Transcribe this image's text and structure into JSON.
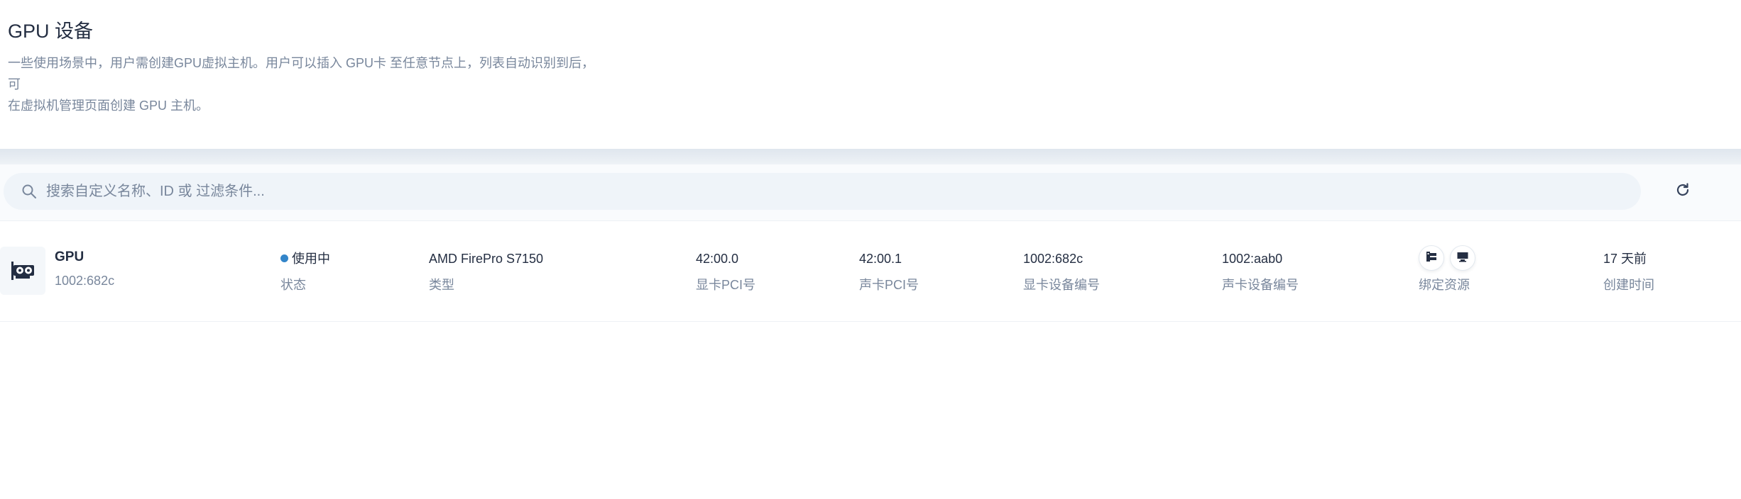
{
  "header": {
    "title": "GPU 设备",
    "description_line1": "一些使用场景中，用户需创建GPU虚拟主机。用户可以插入 GPU卡 至任意节点上，列表自动识别到后，可",
    "description_line2": "在虚拟机管理页面创建 GPU 主机。"
  },
  "toolbar": {
    "search_placeholder": "搜索自定义名称、ID 或 过滤条件...",
    "search_value": "",
    "search_icon": "search-icon",
    "refresh_icon": "refresh-icon"
  },
  "device": {
    "icon": "gpu-card-icon",
    "name": "GPU",
    "id": "1002:682c",
    "status_value": "使用中",
    "status_label": "状态",
    "status_color": "#3385c9",
    "type_value": "AMD FirePro S7150",
    "type_label": "类型",
    "gpu_pci_value": "42:00.0",
    "gpu_pci_label": "显卡PCI号",
    "audio_pci_value": "42:00.1",
    "audio_pci_label": "声卡PCI号",
    "gpu_device_id_value": "1002:682c",
    "gpu_device_id_label": "显卡设备编号",
    "audio_device_id_value": "1002:aab0",
    "audio_device_id_label": "声卡设备编号",
    "bound_resources_label": "绑定资源",
    "bound_resource_icons": [
      "host-node-icon",
      "monitor-icon"
    ],
    "created_value": "17 天前",
    "created_label": "创建时间"
  },
  "colors": {
    "title_text": "#242e42",
    "secondary_text": "#79879c",
    "search_bg": "#eff4f9"
  }
}
